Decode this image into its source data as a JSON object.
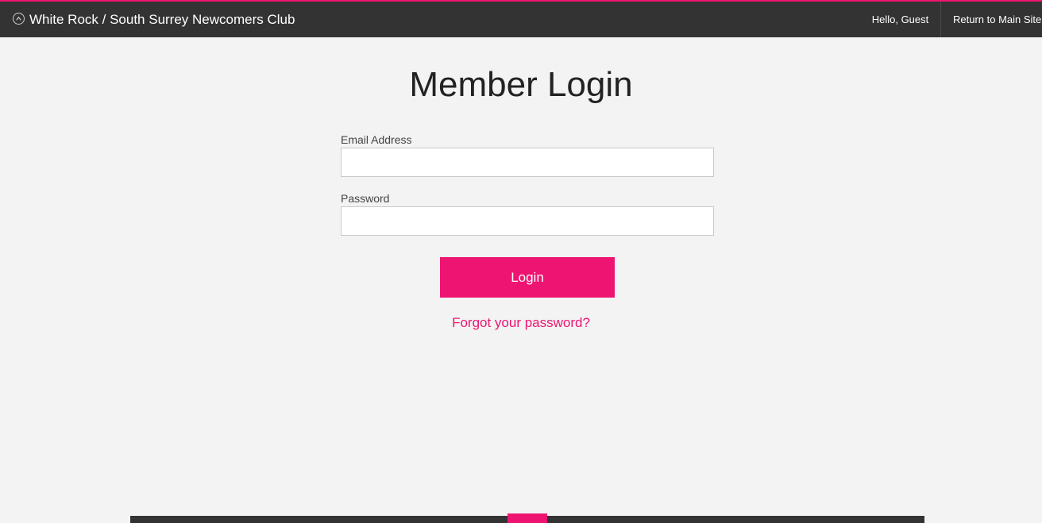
{
  "header": {
    "site_title": "White Rock / South Surrey Newcomers Club",
    "greeting": "Hello, Guest",
    "return_link": "Return to Main Site"
  },
  "icons": {
    "brand": "chevron-up-circle-icon"
  },
  "main": {
    "title": "Member Login",
    "email_label": "Email Address",
    "email_value": "",
    "password_label": "Password",
    "password_value": "",
    "login_button": "Login",
    "forgot_link": "Forgot your password?"
  },
  "colors": {
    "accent": "#ee1572",
    "topbar": "#333333",
    "background": "#f3f3f3"
  }
}
